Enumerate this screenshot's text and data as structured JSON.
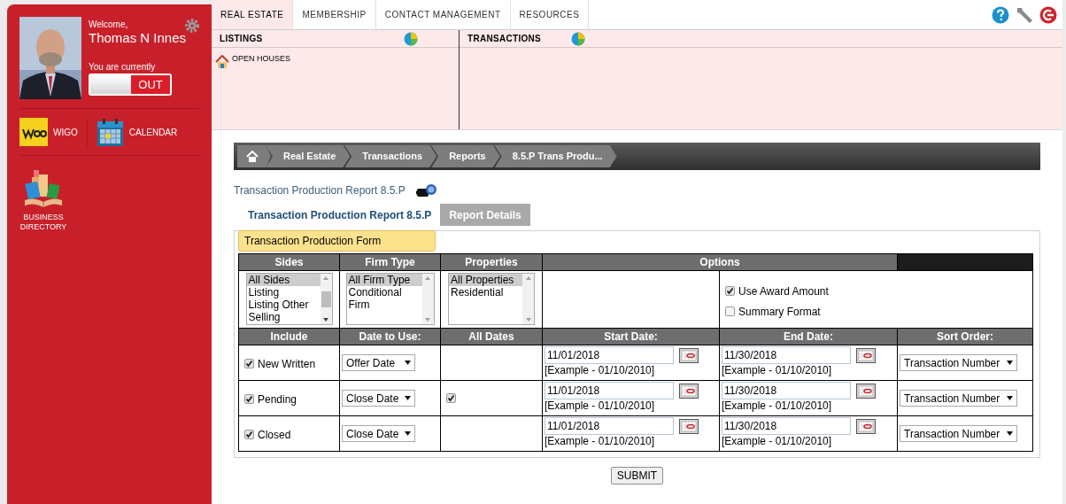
{
  "user": {
    "welcome": "Welcome,",
    "name": "Thomas N Innes",
    "status_label": "You are currently",
    "toggle": {
      "label": "OUT",
      "on": false
    }
  },
  "apps": [
    {
      "kind": "wigo",
      "label": "WIGO"
    },
    {
      "kind": "calendar",
      "label": "CALENDAR"
    },
    {
      "kind": "directory",
      "label": "BUSINESS DIRECTORY"
    }
  ],
  "nav_tabs": [
    {
      "label": "REAL ESTATE",
      "selected": true
    },
    {
      "label": "MEMBERSHIP",
      "selected": false
    },
    {
      "label": "CONTACT MANAGEMENT",
      "selected": false
    },
    {
      "label": "RESOURCES",
      "selected": false
    }
  ],
  "panels": [
    {
      "title": "LISTINGS",
      "items": [
        "OPEN HOUSES"
      ]
    },
    {
      "title": "TRANSACTIONS"
    }
  ],
  "breadcrumb": [
    "Real Estate",
    "Transactions",
    "Reports",
    "8.5.P Trans Produ..."
  ],
  "page_title": "Transaction Production Report 8.5.P",
  "report_tabs": [
    {
      "label": "Transaction Production Report 8.5.P",
      "selected": true
    },
    {
      "label": "Report Details",
      "selected": false
    }
  ],
  "form_title": "Transaction Production Form",
  "filters": [
    {
      "heading": "Sides",
      "scrolled": true,
      "options": [
        {
          "label": "All Sides",
          "selected": true
        },
        {
          "label": "Listing",
          "selected": false
        },
        {
          "label": "Listing Other",
          "selected": false
        },
        {
          "label": "Selling",
          "selected": false
        }
      ]
    },
    {
      "heading": "Firm Type",
      "scrolled": false,
      "options": [
        {
          "label": "All Firm Type",
          "selected": true
        },
        {
          "label": "Conditional",
          "selected": false
        },
        {
          "label": "Firm",
          "selected": false
        }
      ]
    },
    {
      "heading": "Properties",
      "scrolled": false,
      "options": [
        {
          "label": "All Properties",
          "selected": true
        },
        {
          "label": "Residential",
          "selected": false
        }
      ]
    }
  ],
  "options_heading": "Options",
  "options": [
    {
      "label": "Use Award Amount",
      "checked": true
    },
    {
      "label": "Summary Format",
      "checked": false
    }
  ],
  "columns": [
    "Include",
    "Date to Use:",
    "All Dates",
    "Start Date:",
    "End Date:",
    "Sort Order:"
  ],
  "rows": [
    {
      "label": "New Written",
      "checked": true,
      "date_to_use": "Offer Date",
      "all_dates": false,
      "start_date": "11/01/2018",
      "start_hint": "[Example - 01/10/2010]",
      "end_date": "11/30/2018",
      "end_hint": "[Example - 01/10/2010]",
      "sort_order": "Transaction Number"
    },
    {
      "label": "Pending",
      "checked": true,
      "date_to_use": "Close Date",
      "all_dates": true,
      "start_date": "11/01/2018",
      "start_hint": "[Example - 01/10/2010]",
      "end_date": "11/30/2018",
      "end_hint": "[Example - 01/10/2010]",
      "sort_order": "Transaction Number"
    },
    {
      "label": "Closed",
      "checked": true,
      "date_to_use": "Close Date",
      "all_dates": false,
      "start_date": "11/01/2018",
      "start_hint": "[Example - 01/10/2010]",
      "end_date": "11/30/2018",
      "end_hint": "[Example - 01/10/2010]",
      "sort_order": "Transaction Number"
    }
  ],
  "submit": "SUBMIT"
}
